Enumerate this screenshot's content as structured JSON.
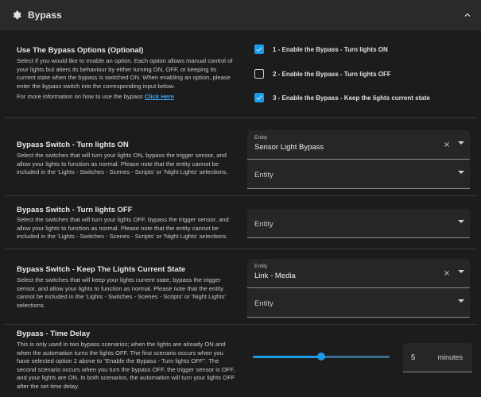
{
  "header": {
    "title": "Bypass",
    "icon": "gear-icon"
  },
  "options": {
    "title": "Use The Bypass Options (Optional)",
    "desc1": "Select if you would like to enable an option. Each option allows manual control of your lights but alters its behaviour by either turning ON, OFF, or keeping its current state when the bypass is switched ON. When enabling an option, please enter the bypass switch into the corresponding input below.",
    "desc2_prefix": "For more information on how to use the bypass ",
    "link": "Click Here",
    "items": [
      {
        "label": "1 - Enable the Bypass - Turn lights ON",
        "checked": true
      },
      {
        "label": "2 - Enable the Bypass - Turn lights OFF",
        "checked": false
      },
      {
        "label": "3 - Enable the Bypass - Keep the lights current state",
        "checked": true
      }
    ]
  },
  "turn_on": {
    "title": "Bypass Switch - Turn lights ON",
    "desc": "Select the switches that will turn your lights ON, bypass the trigger sensor, and allow your lights to function as normal. Please note that the entity cannot be included in the 'Lights - Switches - Scenes - Scripts' or 'Night Lights' selections.",
    "field1_label": "Entity",
    "field1_value": "Sensor Light Bypass",
    "field2_placeholder": "Entity"
  },
  "turn_off": {
    "title": "Bypass Switch - Turn lights OFF",
    "desc": "Select the switches that will turn your lights OFF, bypass the trigger sensor, and allow your lights to function as normal. Please note that the entity cannot be included in the 'Lights - Switches - Scenes - Scripts' or 'Night Lights' selections.",
    "field_placeholder": "Entity"
  },
  "keep": {
    "title": "Bypass Switch - Keep The Lights Current State",
    "desc": "Select the switches that will keep your lights current state, bypass the trigger sensor, and allow your lights to function as normal. Please note that the entity cannot be included in the 'Lights - Switches - Scenes - Scripts' or 'Night Lights' selections.",
    "field1_label": "Entity",
    "field1_value": "Link - Media",
    "field2_placeholder": "Entity"
  },
  "delay": {
    "title": "Bypass - Time Delay",
    "desc": "This is only used in two bypass scenarios; when the lights are already ON and when the automation turns the lights OFF. The first scenario occurs when you have selected option 2 above to \"Enable the Bypass - Turn lights OFF\". The second scenario occurs when you turn the bypass OFF, the trigger sensor is OFF, and your lights are ON. In both scenarios, the automation will turn your lights OFF after the set time delay.",
    "value": "5",
    "unit": "minutes",
    "slider_fraction": 0.5
  },
  "colors": {
    "accent": "#1e9be6",
    "background": "#1c1c1c",
    "field": "#262626"
  }
}
